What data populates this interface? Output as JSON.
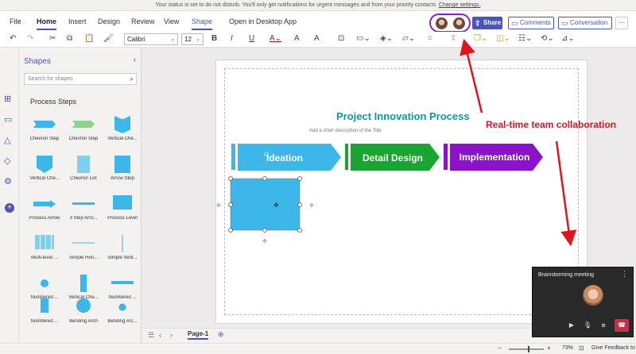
{
  "notification": {
    "text": "Your status is set to do not disturb. You'll only get notifications for urgent messages and from your priority contacts. ",
    "link": "Change settings."
  },
  "ribbon_tabs": [
    "File",
    "Home",
    "Insert",
    "Design",
    "Review",
    "View",
    "Shape"
  ],
  "open_desktop": "Open in Desktop App",
  "buttons": {
    "share": "Share",
    "comments": "Comments",
    "conversation": "Conversation",
    "more": "···"
  },
  "font": {
    "family": "Calibri",
    "size": "12"
  },
  "shapes_panel": {
    "title": "Shapes",
    "search_placeholder": "Search for shapes",
    "section": "Process Steps",
    "items": [
      "Chevron Step",
      "Chevron Step",
      "Vertical Che...",
      "Vertical Che...",
      "Chevron List",
      "Arrow Step",
      "Process Arrow",
      "3 Step Arro...",
      "Process Level",
      "Multi-level ...",
      "Simple Hori...",
      "Simple Verti...",
      "Numbered ...",
      "Vertical Che...",
      "Numbered ...",
      "Numbered ...",
      "Bending Arch",
      "Bending Arc..."
    ]
  },
  "diagram": {
    "title": "Project Innovation Process",
    "subtitle": "Add a short description of the Title",
    "steps": [
      {
        "label": "Ideation",
        "color": "#3db7ea"
      },
      {
        "label": "Detail Design",
        "color": "#1aa533"
      },
      {
        "label": "Implementation",
        "color": "#8a12c9"
      }
    ]
  },
  "annotation": "Real-time team collaboration",
  "meeting": {
    "title": "Brainstorming meeting"
  },
  "page_tab": "Page-1",
  "zoom": {
    "percent": "73%",
    "feedback": "Give Feedback to"
  },
  "colors": {
    "accent": "#4b53bc",
    "annotation": "#e3131b",
    "highlight_ring": "#8f1ec9"
  }
}
